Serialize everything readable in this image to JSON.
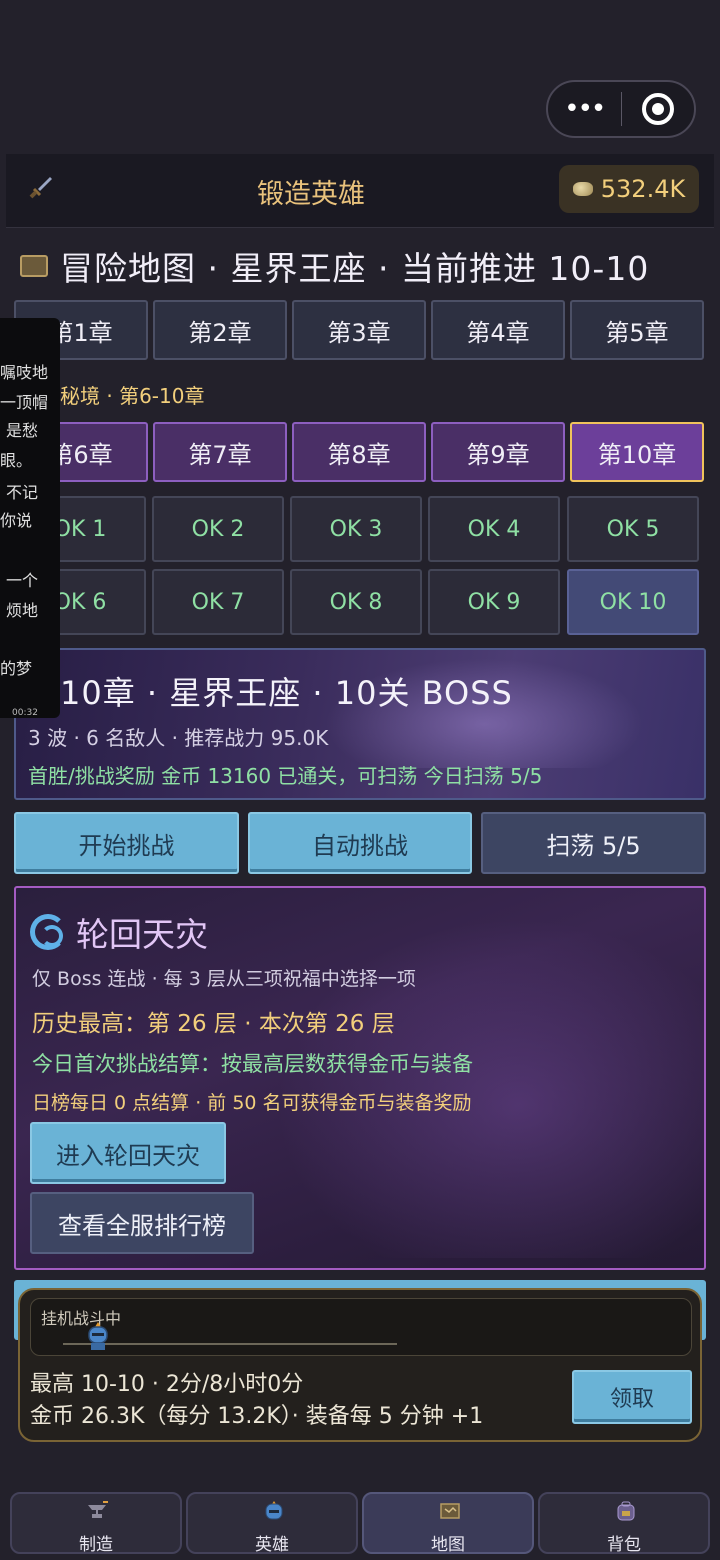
{
  "app": {
    "title": "锻造英雄",
    "gold": "532.4K"
  },
  "map": {
    "title": "冒险地图 · 星界王座 · 当前推进 10-10"
  },
  "chapters_top": [
    "第1章",
    "第2章",
    "第3章",
    "第4章",
    "第5章"
  ],
  "region_label": "秘境 · 第6-10章",
  "chapters_bottom": [
    "第6章",
    "第7章",
    "第8章",
    "第9章",
    "第10章"
  ],
  "stages": [
    "OK 1",
    "OK 2",
    "OK 3",
    "OK 4",
    "OK 5",
    "OK 6",
    "OK 7",
    "OK 8",
    "OK 9",
    "OK 10"
  ],
  "side_panel": {
    "lines": [
      "嘱吱地",
      "一顶帽",
      "是愁",
      "眼。",
      "不记",
      "你说",
      "一个",
      "烦地",
      "的梦"
    ],
    "time": "00:32"
  },
  "boss": {
    "title": "10章 · 星界王座 · 10关 BOSS",
    "info": "3 波 · 6 名敌人 · 推荐战力 95.0K",
    "reward": "首胜/挑战奖励  金币 13160   已通关，可扫荡   今日扫荡 5/5"
  },
  "actions": {
    "start": "开始挑战",
    "auto": "自动挑战",
    "sweep": "扫荡 5/5"
  },
  "reincarnation": {
    "title": "轮回天灾",
    "desc": "仅 Boss 连战 · 每 3 层从三项祝福中选择一项",
    "record": "历史最高：第 26 层  ·  本次第 26 层",
    "daily": "今日首次挑战结算：按最高层数获得金币与装备",
    "rank_note": "日榜每日 0 点结算 · 前 50 名可获得金币与装备奖励",
    "enter_button": "进入轮回天灾",
    "rank_button": "查看全服排行榜"
  },
  "idle": {
    "status": "挂机战斗中",
    "line1": "最高 10-10 · 2分/8小时0分",
    "line2": "金币 26.3K（每分 13.2K）· 装备每 5 分钟 +1",
    "claim": "领取"
  },
  "nav": [
    "制造",
    "英雄",
    "地图",
    "背包"
  ],
  "colors": {
    "accent_gold": "#e9c27c",
    "ok_green": "#8fe0a4",
    "button_blue": "#6ab3d6",
    "purple_border": "#a45cc2"
  }
}
